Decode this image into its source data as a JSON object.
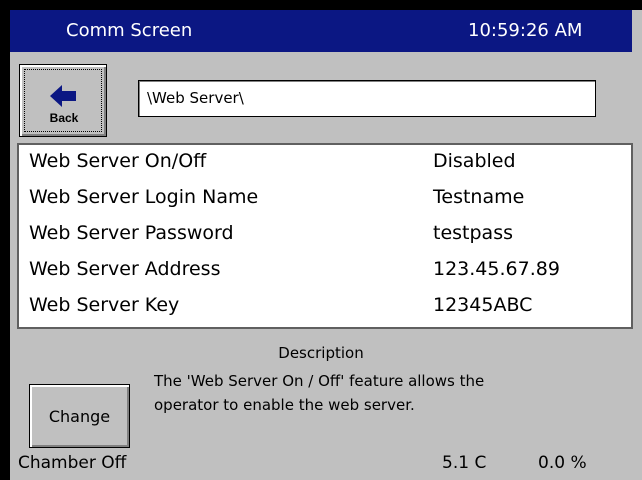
{
  "header": {
    "title": "Comm Screen",
    "time": "10:59:26 AM"
  },
  "toolbar": {
    "back_label": "Back",
    "path": "\\Web Server\\"
  },
  "settings": {
    "rows": [
      {
        "name": "Web Server On/Off",
        "value": "Disabled"
      },
      {
        "name": "Web Server Login Name",
        "value": "Testname"
      },
      {
        "name": "Web Server Password",
        "value": "testpass"
      },
      {
        "name": "Web Server Address",
        "value": "123.45.67.89"
      },
      {
        "name": "Web Server Key",
        "value": "12345ABC"
      }
    ]
  },
  "description": {
    "title": "Description",
    "line1": "The 'Web Server On / Off' feature allows the",
    "line2": "operator to enable the web server."
  },
  "actions": {
    "change_label": "Change"
  },
  "status": {
    "chamber": "Chamber Off",
    "temperature": "5.1 C",
    "humidity": "0.0 %"
  },
  "colors": {
    "titlebar": "#0b1783",
    "panel": "#c0c0c0"
  },
  "icons": {
    "back": "left-arrow-icon"
  }
}
